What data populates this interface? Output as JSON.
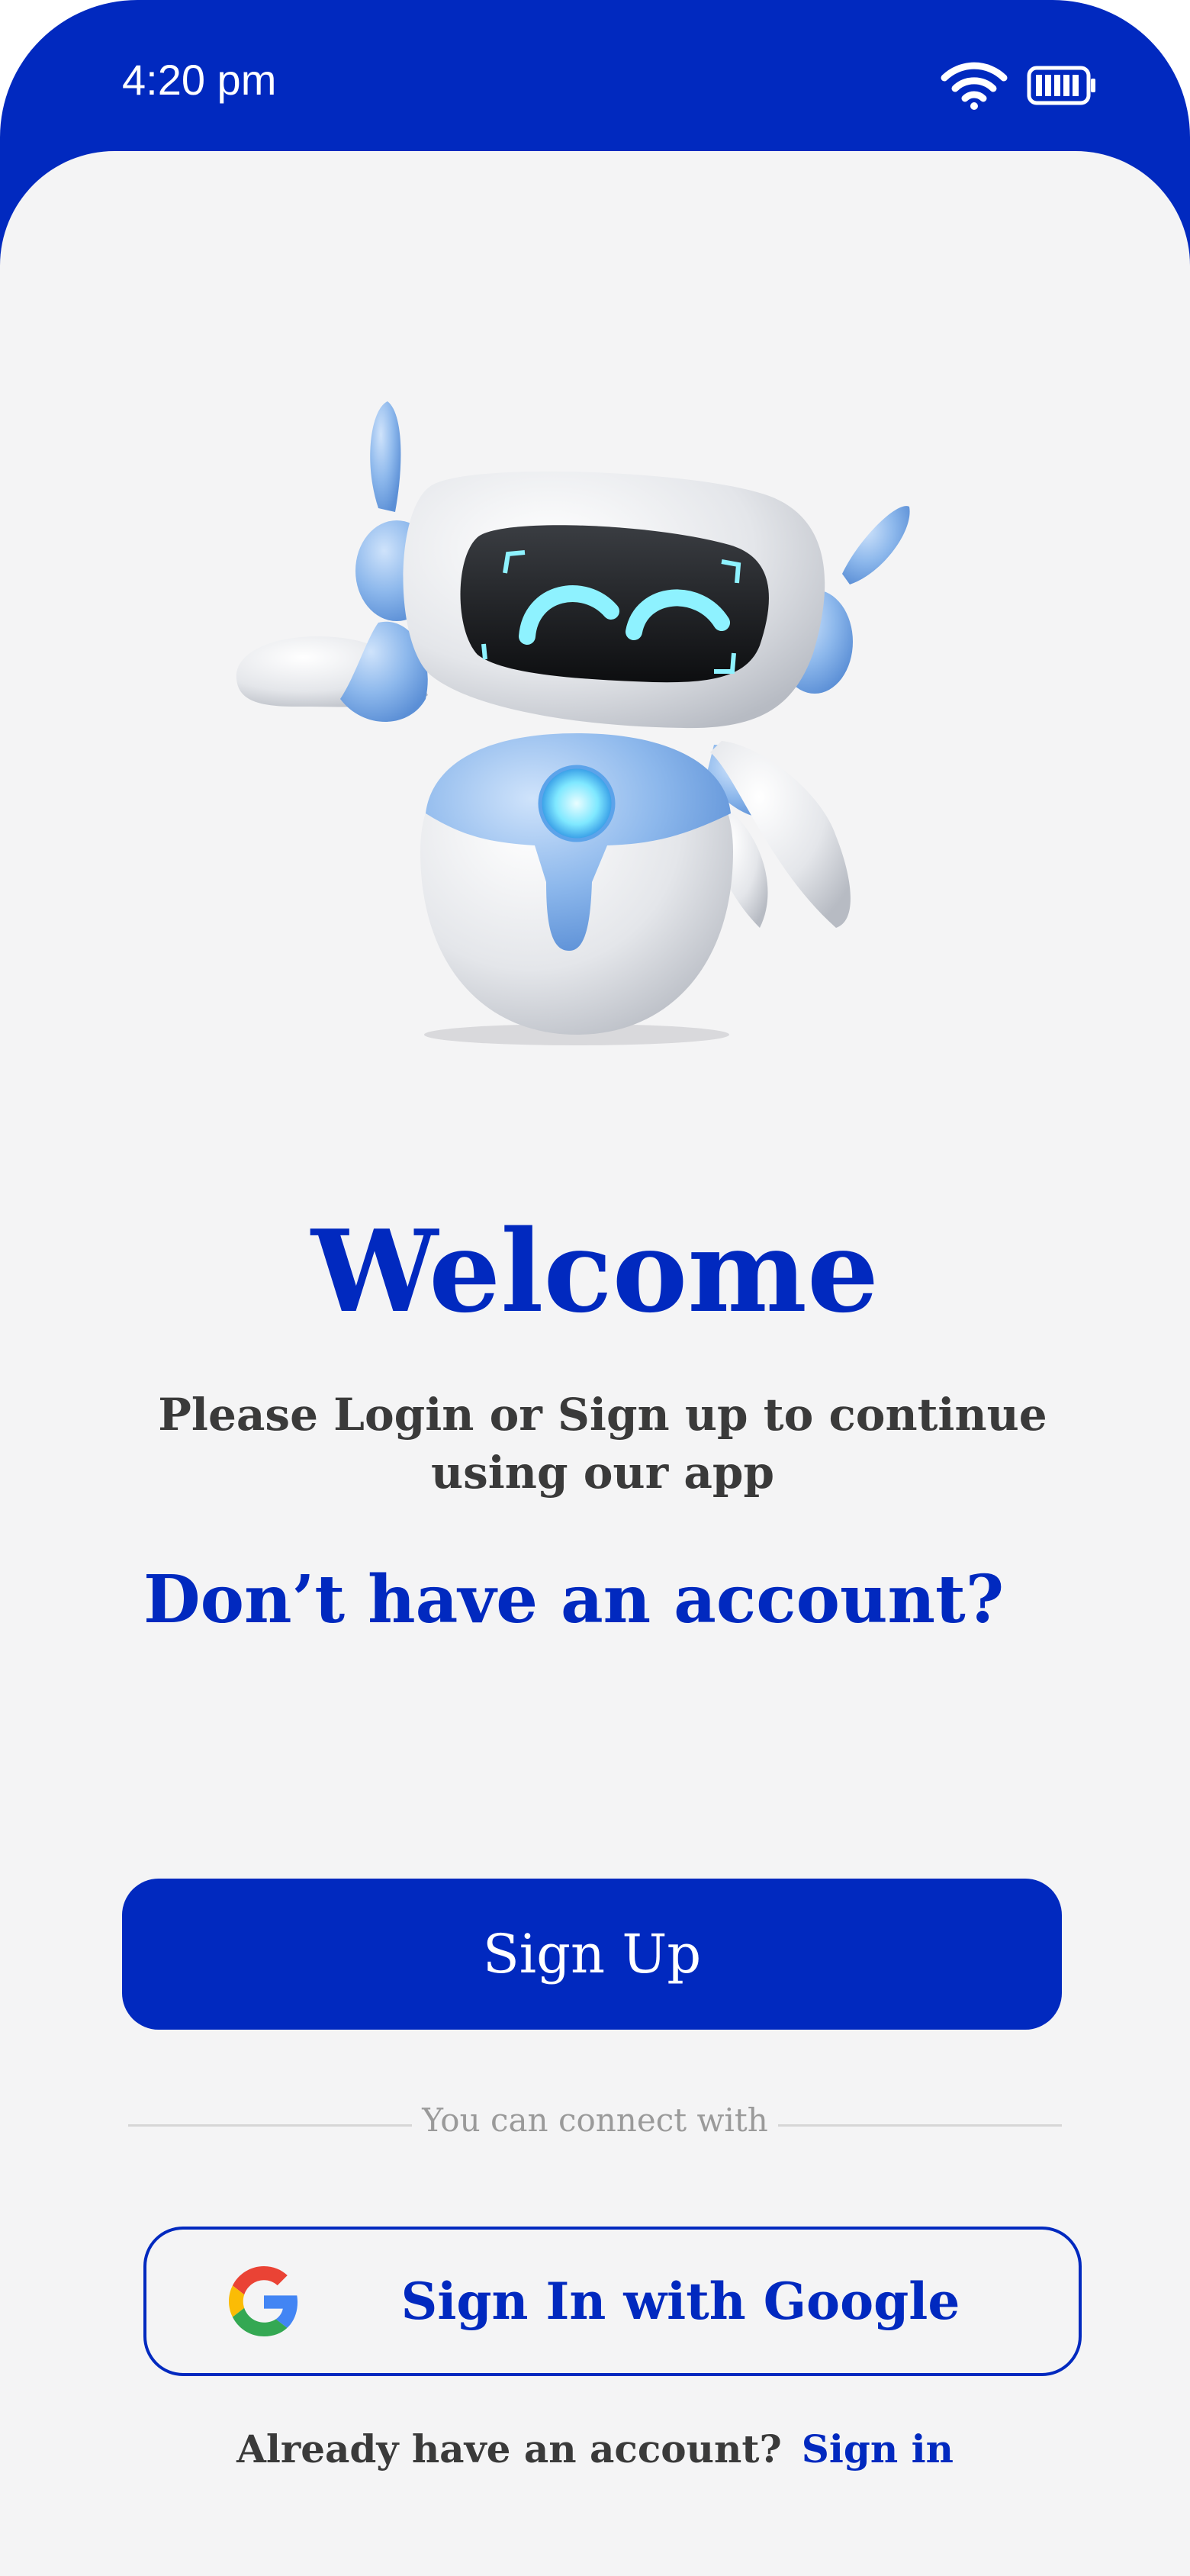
{
  "status_bar": {
    "time": "4:20 pm",
    "wifi_icon": "wifi-icon",
    "battery_icon": "battery-icon"
  },
  "hero": {
    "icon": "robot-mascot-illustration"
  },
  "welcome": {
    "title": "Welcome",
    "subtitle": "Please Login or Sign up to continue using our app"
  },
  "no_account_heading": "Don’t have an account?",
  "signup_button": {
    "label": "Sign Up"
  },
  "divider": {
    "text": "You can connect with"
  },
  "google_button": {
    "label": "Sign In with Google",
    "icon": "google-icon"
  },
  "footer": {
    "text": "Already have an account?",
    "link": "Sign in"
  },
  "colors": {
    "primary": "#0129bf",
    "background": "#f4f4f5",
    "text": "#3a3a3a",
    "muted": "#9a9a9a"
  }
}
